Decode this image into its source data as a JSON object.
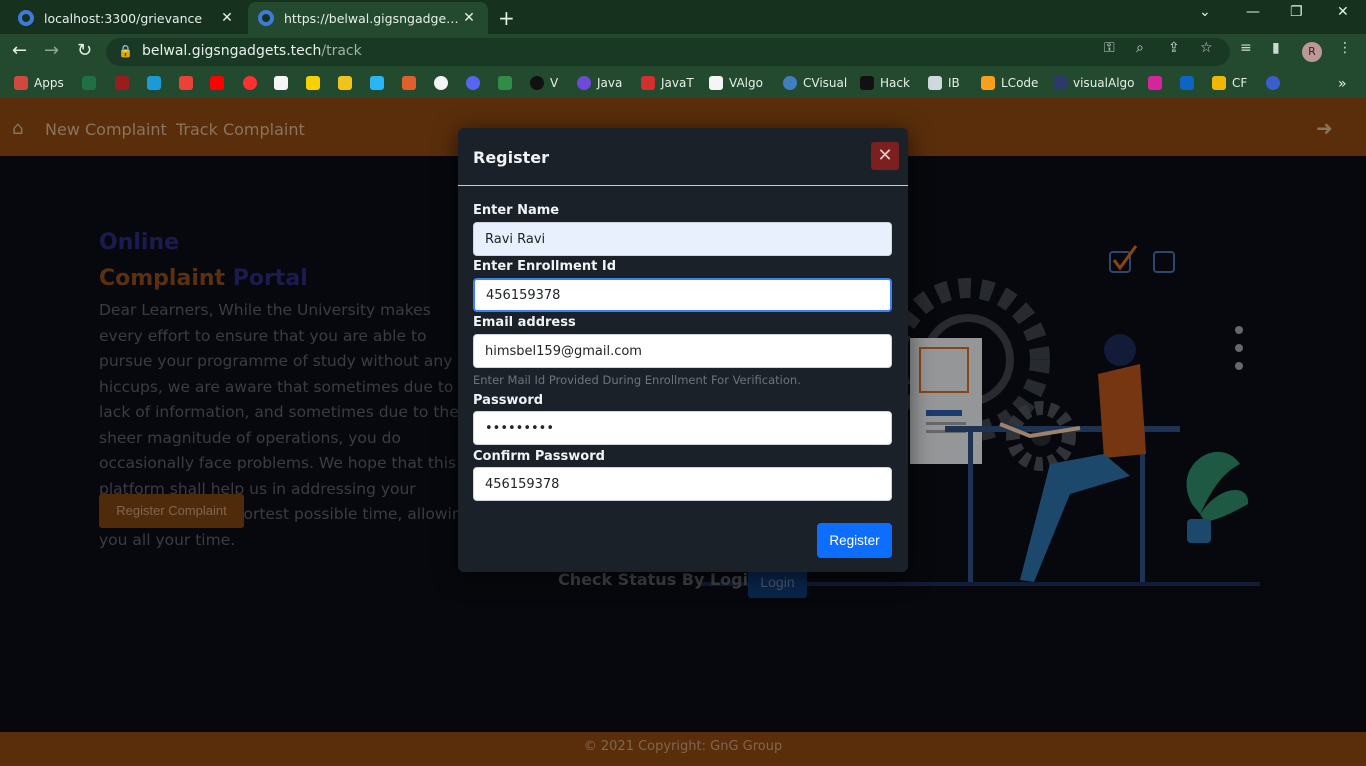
{
  "browser": {
    "tabs": [
      {
        "title": "localhost:3300/grievance"
      },
      {
        "title": "https://belwal.gigsngadgets.tech/track"
      }
    ],
    "url_host": "belwal.gigsngadgets.tech",
    "url_path": "/track",
    "profile_initial": "R",
    "bookmarks": [
      {
        "label": "Apps"
      },
      {
        "label": "V"
      },
      {
        "label": "Java"
      },
      {
        "label": "JavaT"
      },
      {
        "label": "VAlgo"
      },
      {
        "label": "CVisual"
      },
      {
        "label": "Hack"
      },
      {
        "label": "IB"
      },
      {
        "label": "LCode"
      },
      {
        "label": "visualAlgo"
      },
      {
        "label": "CF"
      }
    ]
  },
  "navbar": {
    "new_complaint": "New Complaint",
    "track_complaint": "Track Complaint"
  },
  "hero": {
    "title_online": "Online",
    "title_complaint": "Complaint",
    "title_portal": "Portal",
    "description": "Dear Learners, While the University makes every effort to ensure that you are able to pursue your programme of study without any hiccups, we are aware that sometimes due to lack of information, and sometimes due to the sheer magnitude of operations, you do occasionally face problems. We hope that this platform shall help us in addressing your problems in the shortest possible time, allowing you all your time.",
    "register_button": "Register Complaint",
    "status_label": "Check Status By Login",
    "login_button": "Login"
  },
  "footer": {
    "text": "© 2021 Copyright: GnG Group"
  },
  "modal": {
    "title": "Register",
    "close_symbol": "✕",
    "name_label": "Enter Name",
    "name_value": "Ravi Ravi",
    "enrollment_label": "Enter Enrollment Id",
    "enrollment_value": "456159378",
    "email_label": "Email address",
    "email_value": "himsbel159@gmail.com",
    "email_hint": "Enter Mail Id Provided During Enrollment For Verification.",
    "password_label": "Password",
    "password_value": "456159378",
    "confirm_label": "Confirm Password",
    "confirm_value": "456159378",
    "submit_label": "Register"
  },
  "colors": {
    "chrome_bar": "#234a2e",
    "navbar": "#8b4811",
    "primary_button": "#0d6efd",
    "close_button": "#7b1f1f"
  }
}
